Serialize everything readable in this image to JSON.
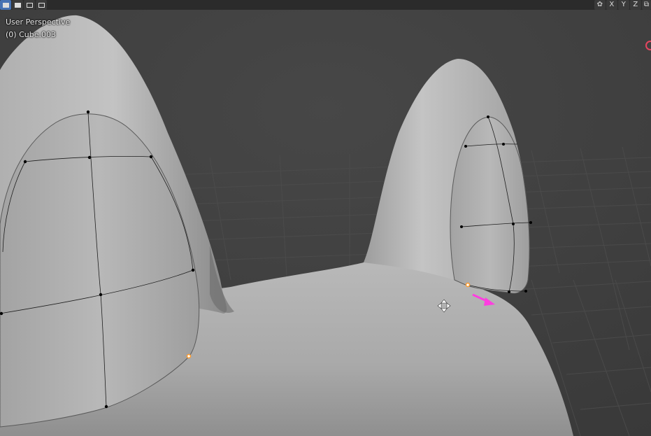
{
  "viewport": {
    "view_name": "User Perspective",
    "object_label": "(0) Cube.003"
  },
  "header": {
    "select_modes": [
      {
        "icon": "select-set-icon",
        "active": true
      },
      {
        "icon": "select-extend-icon",
        "active": false
      },
      {
        "icon": "select-subtract-icon",
        "active": false
      },
      {
        "icon": "select-invert-icon",
        "active": false
      }
    ],
    "mirror_icon": "butterfly-mirror-icon",
    "axes": [
      "X",
      "Y",
      "Z"
    ]
  },
  "colors": {
    "background": "#3d3d3d",
    "mesh": "#b4b4b4",
    "wire": "#1e1e1e",
    "vertex": "#000000",
    "selected_vertex": "#ff9a2a",
    "annotation_arrow": "#ff3ee0",
    "gizmo_red": "#e5455f"
  }
}
